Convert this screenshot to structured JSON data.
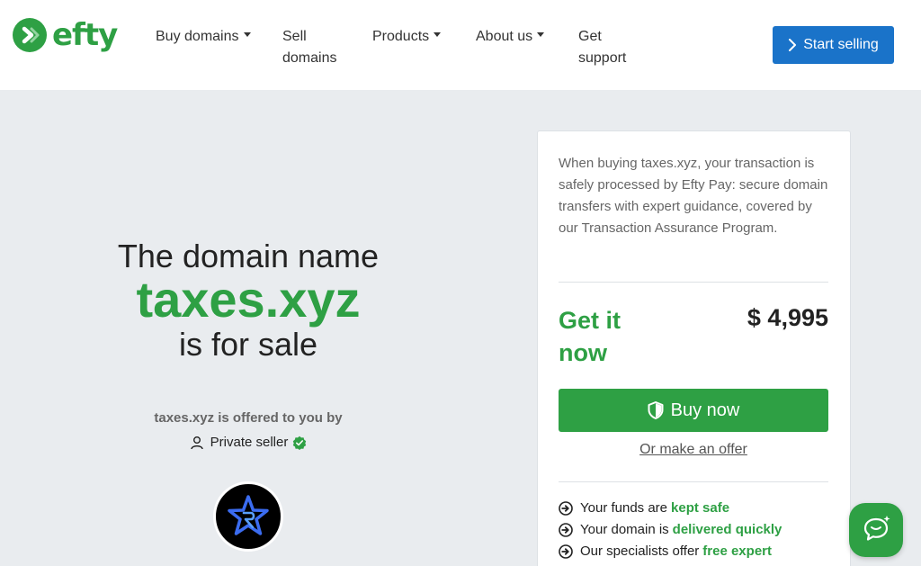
{
  "header": {
    "logo_text": "efty",
    "nav": [
      {
        "label": "Buy domains",
        "dropdown": true
      },
      {
        "label_line1": "Sell",
        "label_line2": "domains"
      },
      {
        "label": "Products",
        "dropdown": true
      },
      {
        "label": "About us",
        "dropdown": true
      },
      {
        "label_line1": "Get",
        "label_line2": "support"
      }
    ],
    "cta_label": "Start selling"
  },
  "hero": {
    "line1": "The domain name",
    "domain": "taxes.xyz",
    "line3": "is for sale",
    "offered_text": "taxes.xyz is offered to you by",
    "seller_label": "Private seller"
  },
  "card": {
    "intro": "When buying taxes.xyz, your transaction is safely processed by Efty Pay: secure domain transfers with expert guidance, covered by our Transaction Assurance Program.",
    "get_it_label": "Get it now",
    "price": "$ 4,995",
    "buy_label": "Buy now",
    "offer_label": "Or make an offer",
    "benefits": [
      {
        "text": "Your funds are",
        "highlight": "kept safe"
      },
      {
        "text": "Your domain is",
        "highlight": "delivered quickly"
      },
      {
        "text": "Our specialists offer",
        "highlight": "free expert"
      }
    ]
  },
  "colors": {
    "brand_green": "#2ea044",
    "cta_blue": "#1a73c9",
    "page_bg": "#e9ecef"
  },
  "icons": {
    "logo": "efty-logo-icon",
    "cta": "chevron-right-icon",
    "seller": "person-icon",
    "verified": "verified-badge-icon",
    "buy": "shield-icon",
    "benefit": "arrow-circle-icon",
    "chat": "chat-bubble-icon"
  }
}
